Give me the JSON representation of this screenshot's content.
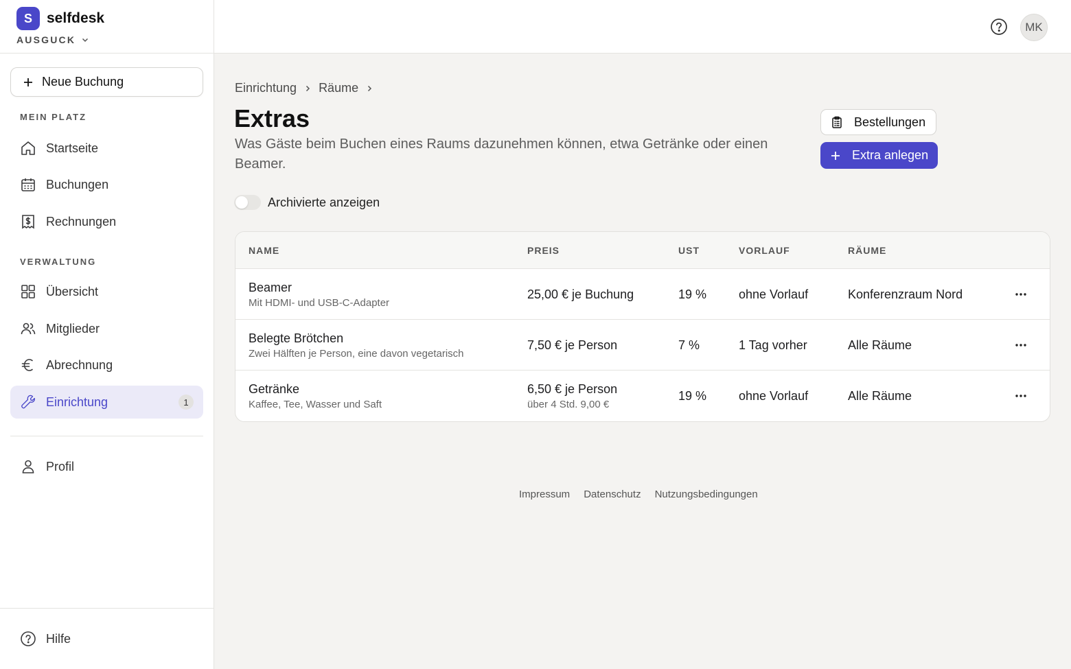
{
  "brand": {
    "logo_letter": "S",
    "name": "selfdesk",
    "workspace": "AUSGUCK"
  },
  "sidebar": {
    "new_booking": "Neue Buchung",
    "section_my_place": "MEIN PLATZ",
    "section_admin": "VERWALTUNG",
    "items": [
      {
        "label": "Startseite",
        "icon": "home-icon"
      },
      {
        "label": "Buchungen",
        "icon": "calendar-icon"
      },
      {
        "label": "Rechnungen",
        "icon": "invoice-icon"
      },
      {
        "label": "Übersicht",
        "icon": "grid-icon"
      },
      {
        "label": "Mitglieder",
        "icon": "users-icon"
      },
      {
        "label": "Abrechnung",
        "icon": "euro-icon"
      },
      {
        "label": "Einrichtung",
        "icon": "wrench-icon",
        "active": true,
        "badge": "1"
      },
      {
        "label": "Profil",
        "icon": "user-icon"
      }
    ],
    "help": "Hilfe"
  },
  "topbar": {
    "avatar_initials": "MK"
  },
  "breadcrumb": {
    "items": [
      "Einrichtung",
      "Räume"
    ]
  },
  "page": {
    "title": "Extras",
    "subtitle": "Was Gäste beim Buchen eines Raums dazunehmen können, etwa Getränke oder einen Beamer.",
    "orders_button": "Bestellungen",
    "add_button": "Extra anlegen",
    "archived_toggle": "Archivierte anzeigen"
  },
  "table": {
    "headers": [
      "NAME",
      "PREIS",
      "UST",
      "VORLAUF",
      "RÄUME"
    ],
    "rows": [
      {
        "name": "Beamer",
        "desc": "Mit HDMI- und USB-C-Adapter",
        "price": "25,00 € je Buchung",
        "price_sub": "",
        "vat": "19 %",
        "lead": "ohne Vorlauf",
        "rooms": "Konferenzraum Nord"
      },
      {
        "name": "Belegte Brötchen",
        "desc": "Zwei Hälften je Person, eine davon vegetarisch",
        "price": "7,50 € je Person",
        "price_sub": "",
        "vat": "7 %",
        "lead": "1 Tag vorher",
        "rooms": "Alle Räume"
      },
      {
        "name": "Getränke",
        "desc": "Kaffee, Tee, Wasser und Saft",
        "price": "6,50 € je Person",
        "price_sub": "über 4 Std. 9,00 €",
        "vat": "19 %",
        "lead": "ohne Vorlauf",
        "rooms": "Alle Räume"
      }
    ]
  },
  "footer": {
    "links": [
      "Impressum",
      "Datenschutz",
      "Nutzungsbedingungen"
    ]
  },
  "colors": {
    "accent": "#4a47c9",
    "active_bg": "#ebeaf8",
    "page_bg": "#f4f3f1"
  }
}
